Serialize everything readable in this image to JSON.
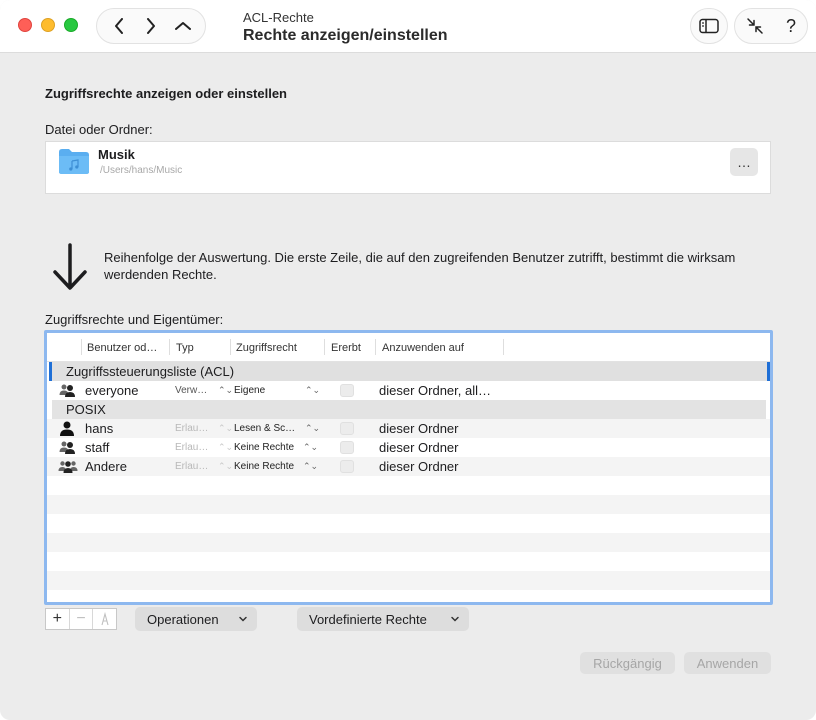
{
  "window": {
    "title_small": "ACL-Rechte",
    "title_big": "Rechte anzeigen/einstellen"
  },
  "toolbar": {
    "back_icon": "chevron-left-icon",
    "forward_icon": "chevron-right-icon",
    "up_icon": "chevron-up-icon",
    "sidebar_icon": "sidebar-icon",
    "collapse_icon": "collapse-arrows-icon",
    "help_label": "?"
  },
  "main": {
    "section_heading": "Zugriffsrechte anzeigen oder einstellen",
    "file_label": "Datei oder Ordner:",
    "file": {
      "name": "Musik",
      "path": "/Users/hans/Music",
      "browse_label": "…"
    },
    "info_text": "Reihenfolge der Auswertung. Die erste Zeile, die auf den zugreifenden Benutzer zutrifft, bestimmt die wirksam werdenden Rechte.",
    "table_label": "Zugriffsrechte und Eigentümer:"
  },
  "table": {
    "columns": [
      "Benutzer od…",
      "Typ",
      "Zugriffsrecht",
      "Ererbt",
      "Anzuwenden auf"
    ],
    "group_acl": "Zugriffssteuerungsliste (ACL)",
    "group_posix": "POSIX",
    "rows": [
      {
        "user": "everyone",
        "icon": "group-icon",
        "typ": "Verw…",
        "right": "Eigene",
        "apply": "dieser Ordner, all…"
      },
      {
        "user": "hans",
        "icon": "user-icon",
        "typ": "Erlau…",
        "right": "Lesen & Sc…",
        "apply": "dieser Ordner"
      },
      {
        "user": "staff",
        "icon": "group-icon",
        "typ": "Erlau…",
        "right": "Keine Rechte",
        "apply": "dieser Ordner"
      },
      {
        "user": "Andere",
        "icon": "others-icon",
        "typ": "Erlau…",
        "right": "Keine Rechte",
        "apply": "dieser Ordner"
      }
    ]
  },
  "footer": {
    "add_label": "+",
    "remove_label": "−",
    "edit_icon": "pen-icon",
    "operations_label": "Operationen",
    "predefined_label": "Vordefinierte Rechte",
    "revert_label": "Rückgängig",
    "apply_label": "Anwenden"
  }
}
